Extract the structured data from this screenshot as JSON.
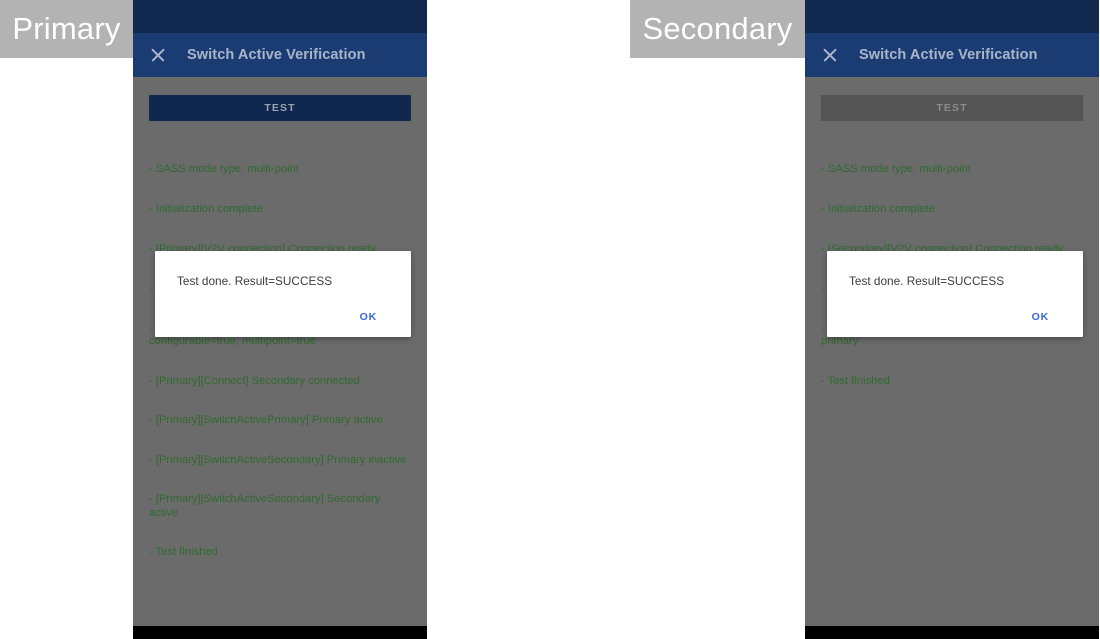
{
  "panels": [
    {
      "role_label": "Primary",
      "app_bar": {
        "close_icon": "close-icon",
        "title": "Switch Active Verification"
      },
      "test_button": {
        "label": "TEST",
        "state": "enabled"
      },
      "log_lines": [
        "- SASS mode type: multi-point",
        "- Initialization complete",
        "- [Primary][V2V connection] Connection ready",
        "- [Primary][Connect] Connected",
        "- [Primary][GetCapability] Decode done, sass=true, configurable=true, multipoint=true",
        "- [Primary][Connect] Secondary connected",
        "- [Primary][SwitchActivePrimary] Primary active",
        "- [Primary][SwitchActiveSecondary] Primary inactive",
        "- [Primary][SwitchActiveSecondary] Secondary active",
        "- Test finished"
      ],
      "dialog": {
        "message": "Test done. Result=SUCCESS",
        "ok_label": "OK"
      }
    },
    {
      "role_label": "Secondary",
      "app_bar": {
        "close_icon": "close-icon",
        "title": "Switch Active Verification"
      },
      "test_button": {
        "label": "TEST",
        "state": "disabled"
      },
      "log_lines": [
        "- SASS mode type: multi-point",
        "- Initialization complete",
        "- [Secondary][V2V connection] Connection ready",
        "- [Secondary][Connect] Send result to primary",
        "- [Secondary][SwitchActiveSecondary] Send result to primary",
        "- Test finished"
      ],
      "dialog": {
        "message": "Test done. Result=SUCCESS",
        "ok_label": "OK"
      }
    }
  ],
  "colors": {
    "status_bar": "#11294f",
    "app_bar": "#1a3c73",
    "screen_scrim": "#6b6b6b",
    "log_text": "#2f6b2f",
    "button_enabled_bg": "#11284e",
    "button_disabled_bg": "#555555",
    "dialog_bg": "#ffffff",
    "dialog_action_text": "#3367d6",
    "badge_bg": "#b3b3b3",
    "nav_bar": "#000000"
  }
}
